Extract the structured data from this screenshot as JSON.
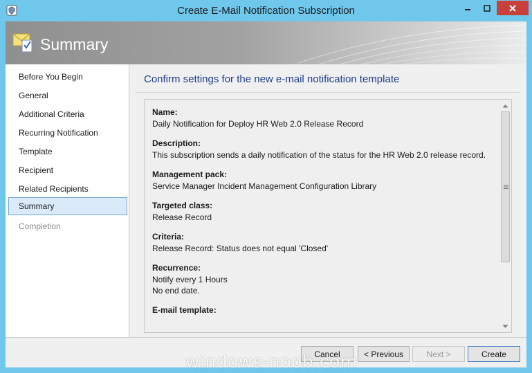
{
  "window": {
    "title": "Create E-Mail Notification Subscription"
  },
  "banner": {
    "title": "Summary"
  },
  "nav": {
    "items": [
      {
        "label": "Before You Begin"
      },
      {
        "label": "General"
      },
      {
        "label": "Additional Criteria"
      },
      {
        "label": "Recurring Notification"
      },
      {
        "label": "Template"
      },
      {
        "label": "Recipient"
      },
      {
        "label": "Related Recipients"
      },
      {
        "label": "Summary"
      },
      {
        "label": "Completion"
      }
    ],
    "selected": "Summary",
    "disabled": "Completion"
  },
  "content": {
    "heading": "Confirm settings for the new e-mail notification template",
    "sections": [
      {
        "label": "Name:",
        "lines": [
          "Daily Notification for Deploy HR Web 2.0 Release Record"
        ]
      },
      {
        "label": "Description:",
        "lines": [
          "This subscription sends a daily notification of the status for the HR Web 2.0 release record."
        ]
      },
      {
        "label": "Management pack:",
        "lines": [
          "Service Manager Incident Management Configuration Library"
        ]
      },
      {
        "label": "Targeted class:",
        "lines": [
          "Release Record"
        ]
      },
      {
        "label": "Criteria:",
        "lines": [
          "Release Record: Status does not equal 'Closed'"
        ]
      },
      {
        "label": "Recurrence:",
        "lines": [
          "Notify every 1 Hours",
          "No end date."
        ]
      },
      {
        "label": "E-mail template:",
        "lines": []
      }
    ]
  },
  "footer": {
    "cancel_label": "Cancel",
    "previous_label": "< Previous",
    "next_label": "Next >",
    "create_label": "Create"
  },
  "watermark": {
    "text": "windows-noob.com"
  },
  "colors": {
    "titlebar": "#6fc7ec",
    "close_button": "#c7403a",
    "heading": "#1f3c88",
    "selected_item": "#dbeaf9"
  }
}
